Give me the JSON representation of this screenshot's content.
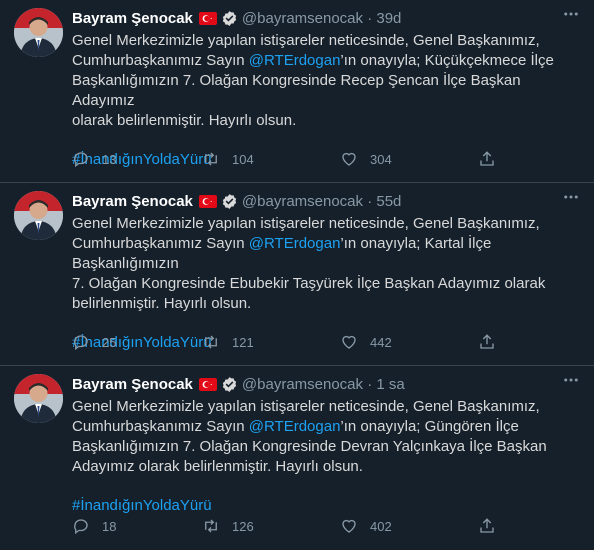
{
  "tweets": [
    {
      "name": "Bayram Şenocak",
      "handle": "@bayramsenocak",
      "sep": "·",
      "time": "39d",
      "text_before": "Genel Merkezimizle yapılan istişareler neticesinde, Genel Başkanımız,\nCumhurbaşkanımız Sayın ",
      "mention": "@RTErdogan",
      "text_after": "’ın onayıyla; Küçükçekmece İlçe\nBaşkanlığımızın 7. Olağan Kongresinde Recep Şencan İlçe Başkan Adayımız\nolarak belirlenmiştir. Hayırlı olsun.",
      "hashtag": "#İnandığınYoldaYürü",
      "replies": "13",
      "retweets": "104",
      "likes": "304"
    },
    {
      "name": "Bayram Şenocak",
      "handle": "@bayramsenocak",
      "sep": "·",
      "time": "55d",
      "text_before": "Genel Merkezimizle yapılan istişareler neticesinde, Genel Başkanımız,\nCumhurbaşkanımız Sayın ",
      "mention": "@RTErdogan",
      "text_after": "’ın onayıyla; Kartal İlçe Başkanlığımızın\n7. Olağan Kongresinde Ebubekir Taşyürek İlçe Başkan Adayımız olarak\nbelirlenmiştir. Hayırlı olsun.",
      "hashtag": "#İnandığınYoldaYürü",
      "replies": "25",
      "retweets": "121",
      "likes": "442"
    },
    {
      "name": "Bayram Şenocak",
      "handle": "@bayramsenocak",
      "sep": "·",
      "time": "1 sa",
      "text_before": "Genel Merkezimizle yapılan istişareler neticesinde, Genel Başkanımız,\nCumhurbaşkanımız Sayın ",
      "mention": "@RTErdogan",
      "text_after": "’ın onayıyla; Güngören İlçe\nBaşkanlığımızın 7. Olağan Kongresinde Devran Yalçınkaya İlçe Başkan\nAdayımız olarak belirlenmiştir. Hayırlı olsun.",
      "hashtag": "#İnandığınYoldaYürü",
      "replies": "18",
      "retweets": "126",
      "likes": "402"
    }
  ],
  "icons": {
    "avatar": "avatar",
    "flag": "turkey-flag-icon",
    "verified": "verified-badge-icon",
    "more": "more-options-icon",
    "reply": "reply-icon",
    "retweet": "retweet-icon",
    "like": "heart-icon",
    "share": "share-icon"
  },
  "colors": {
    "background": "#15202b",
    "divider": "#38444d",
    "text": "#d9d9d9",
    "secondary": "#8899a6",
    "accent": "#1da1f2",
    "flag_red": "#e30a17"
  }
}
